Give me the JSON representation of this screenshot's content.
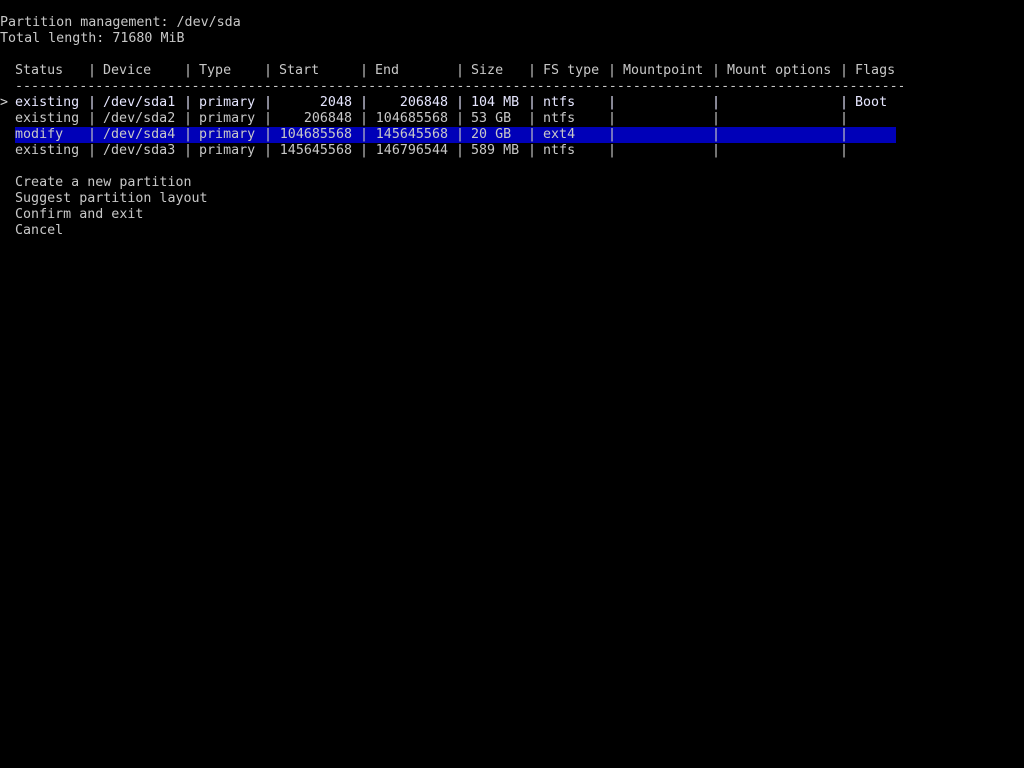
{
  "header": {
    "title": "Partition management: /dev/sda",
    "total_length": "Total length: 71680 MiB"
  },
  "table": {
    "columns": [
      "Status",
      "Device",
      "Type",
      "Start",
      "End",
      "Size",
      "FS type",
      "Mountpoint",
      "Mount options",
      "Flags"
    ],
    "divider": "----------------------------------------------------------------------------------------------------------------",
    "separator": "|",
    "cursor": ">",
    "selected_row": 0,
    "rows": [
      {
        "status": "existing",
        "device": "/dev/sda1",
        "type": "primary",
        "start": "2048",
        "end": "206848",
        "size": "104 MB",
        "fstype": "ntfs",
        "mountpoint": "",
        "options": "",
        "flags": "Boot"
      },
      {
        "status": "existing",
        "device": "/dev/sda2",
        "type": "primary",
        "start": "206848",
        "end": "104685568",
        "size": "53 GB",
        "fstype": "ntfs",
        "mountpoint": "",
        "options": "",
        "flags": ""
      },
      {
        "status": "modify",
        "device": "/dev/sda4",
        "type": "primary",
        "start": "104685568",
        "end": "145645568",
        "size": "20 GB",
        "fstype": "ext4",
        "mountpoint": "",
        "options": "",
        "flags": ""
      },
      {
        "status": "existing",
        "device": "/dev/sda3",
        "type": "primary",
        "start": "145645568",
        "end": "146796544",
        "size": "589 MB",
        "fstype": "ntfs",
        "mountpoint": "",
        "options": "",
        "flags": ""
      }
    ]
  },
  "menu": {
    "items": [
      {
        "label": "Create a new partition"
      },
      {
        "label": "Suggest partition layout"
      },
      {
        "label": "Confirm and exit"
      },
      {
        "label": "Cancel"
      }
    ]
  },
  "colors": {
    "background": "#000000",
    "text": "#c8c8c8",
    "selection": "#0000b8"
  }
}
